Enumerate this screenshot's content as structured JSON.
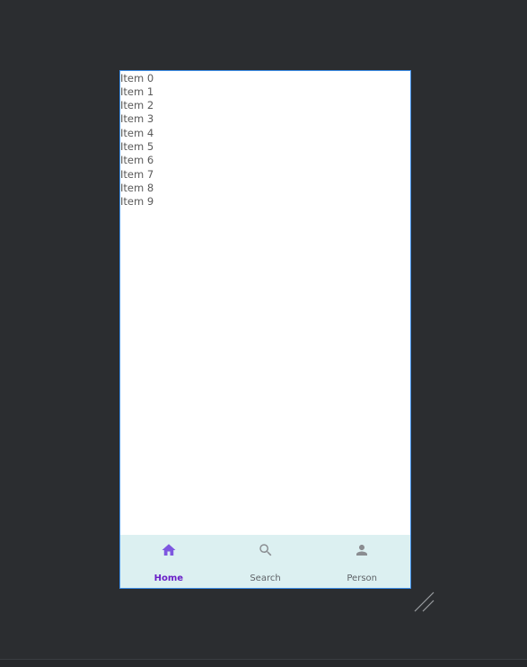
{
  "list": {
    "items": [
      "Item 0",
      "Item 1",
      "Item 2",
      "Item 3",
      "Item 4",
      "Item 5",
      "Item 6",
      "Item 7",
      "Item 8",
      "Item 9"
    ]
  },
  "bottom_nav": {
    "items": [
      {
        "label": "Home",
        "icon": "home-icon",
        "active": true
      },
      {
        "label": "Search",
        "icon": "search-icon",
        "active": false
      },
      {
        "label": "Person",
        "icon": "person-icon",
        "active": false
      }
    ]
  },
  "colors": {
    "canvas_background": "#2b2d30",
    "device_border": "#3d8ee8",
    "nav_background": "#dcf0f1",
    "active": "#6a1fc8",
    "active_icon": "#7e57e0",
    "inactive": "#5f6368"
  }
}
